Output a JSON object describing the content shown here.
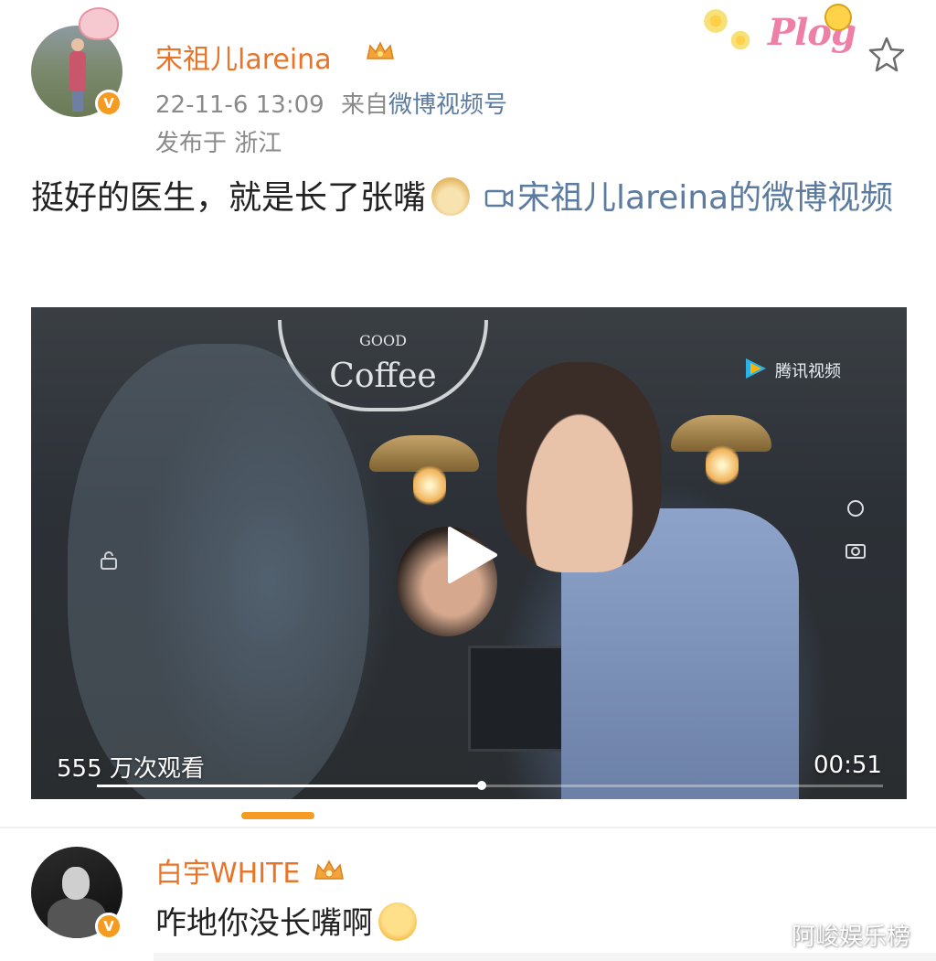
{
  "post": {
    "username": "宋祖儿lareina",
    "timestamp": "22-11-6 13:09",
    "source_prefix": "来自",
    "source": "微博视频号",
    "location": "发布于 浙江",
    "text": "挺好的医生，就是长了张嘴",
    "link_text": "宋祖儿lareina的微博视频",
    "verified_badge": "V",
    "sticker_text": "Plog"
  },
  "video": {
    "sign_text": "Coffee",
    "sign_top_text": "GOOD",
    "channel_logo": "腾讯视频",
    "views": "555 万次观看",
    "duration": "00:51",
    "progress": 0.49
  },
  "comment": {
    "username": "白宇WHITE",
    "text": "咋地你没长嘴啊",
    "verified_badge": "V"
  },
  "watermark": "阿峻娱乐榜",
  "colors": {
    "username": "#e8742a",
    "link": "#5b7ba0",
    "badge": "#f59b22",
    "meta": "#8a8a8a"
  }
}
